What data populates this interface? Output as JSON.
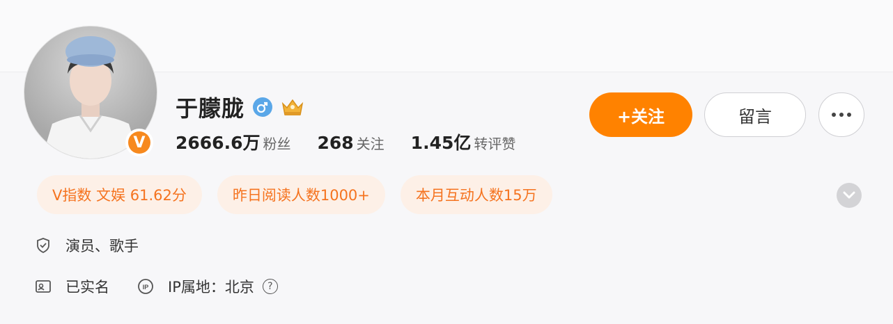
{
  "profile": {
    "name": "于朦胧",
    "verified_mark": "V",
    "gender_symbol": "♂",
    "crown_label": "VIP"
  },
  "stats": [
    {
      "number": "2666.6万",
      "label": "粉丝"
    },
    {
      "number": "268",
      "label": "关注"
    },
    {
      "number": "1.45亿",
      "label": "转评赞"
    }
  ],
  "actions": {
    "follow_label": "+关注",
    "message_label": "留言"
  },
  "tags": [
    "V指数 文娱 61.62分",
    "昨日阅读人数1000+",
    "本月互动人数15万"
  ],
  "info": {
    "occupation": "演员、歌手",
    "real_name_status": "已实名",
    "ip_location": "IP属地：北京",
    "help_symbol": "?"
  },
  "colors": {
    "accent": "#ff8200",
    "tag_bg": "#fdf0e7",
    "tag_text": "#f5731f",
    "gender_blue": "#5aa7e8"
  },
  "icons": [
    "gender-male-icon",
    "crown-icon",
    "shield-icon",
    "id-card-icon",
    "ip-icon",
    "help-icon",
    "chevron-down-icon",
    "more-icon"
  ]
}
